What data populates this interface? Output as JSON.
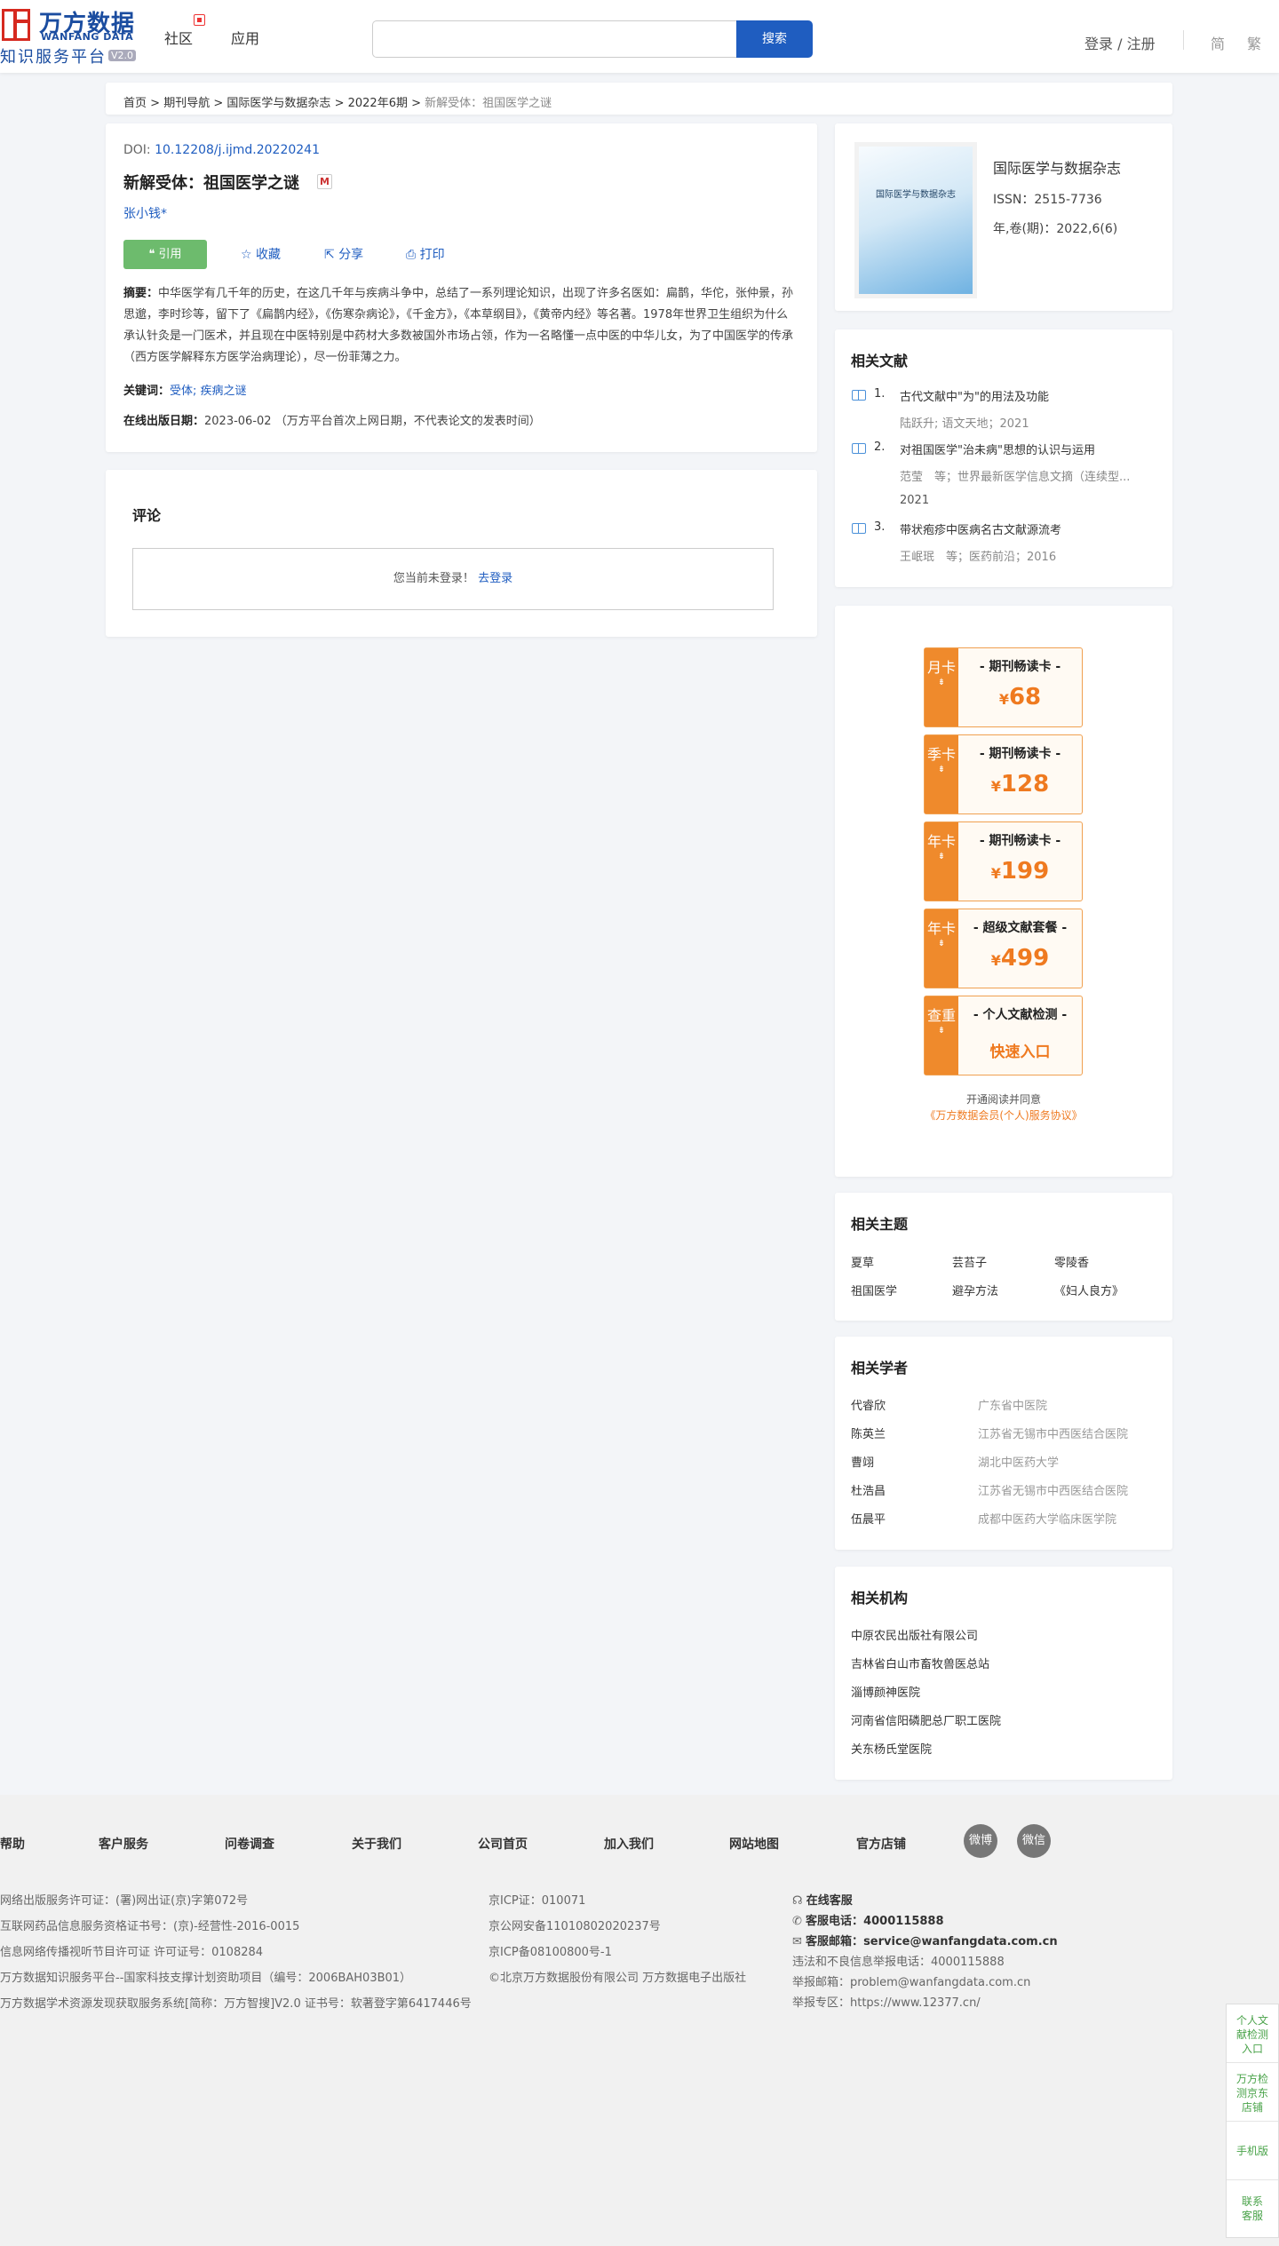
{
  "header": {
    "logo_cn": "万方数据",
    "logo_en": "WANFANG DATA",
    "logo_sub": "知识服务平台",
    "logo_ver": "V2.0",
    "nav": [
      "社区",
      "应用"
    ],
    "search_button": "搜索",
    "login": "登录 / 注册",
    "lang_simplified": "简",
    "lang_traditional": "繁"
  },
  "breadcrumb": {
    "items": [
      "首页",
      "期刊导航",
      "国际医学与数据杂志",
      "2022年6期"
    ],
    "separator": ">",
    "current": "新解受体：祖国医学之谜"
  },
  "article": {
    "doi_label": "DOI:",
    "doi": "10.12208/j.ijmd.20220241",
    "title": "新解受体：祖国医学之谜",
    "m_badge": "M",
    "author": "张小钱*",
    "actions": {
      "cite": "❝ 引用",
      "collect": "收藏",
      "share": "分享",
      "print": "打印"
    },
    "abstract_label": "摘要：",
    "abstract": "中华医学有几千年的历史，在这几千年与疾病斗争中，总结了一系列理论知识，出现了许多名医如：扁鹊，华佗，张仲景，孙思邈，李时珍等，留下了《扁鹊内经》，《伤寒杂病论》，《千金方》，《本草纲目》，《黄帝内经》等名著。1978年世界卫生组织为什么承认针灸是一门医术，并且现在中医特别是中药材大多数被国外市场占领，作为一名略懂一点中医的中华儿女，为了中国医学的传承（西方医学解释东方医学治病理论），尽一份菲薄之力。",
    "keywords_label": "关键词：",
    "keywords": "受体; 疾病之谜",
    "pubdate_label": "在线出版日期：",
    "pubdate": "2023-06-02 （万方平台首次上网日期，不代表论文的发表时间）"
  },
  "comment": {
    "title": "评论",
    "not_logged": "您当前未登录！",
    "login_link": "去登录"
  },
  "journal": {
    "cover_text": "国际医学与数据杂志",
    "name": "国际医学与数据杂志",
    "issn": "ISSN：2515-7736",
    "year": "年,卷(期)：2022,6(6)"
  },
  "related_docs": {
    "title": "相关文献",
    "items": [
      {
        "num": "1.",
        "title": "古代文献中\"为\"的用法及功能",
        "meta": "陆跃升; 语文天地；2021"
      },
      {
        "num": "2.",
        "title": "对祖国医学\"治未病\"思想的认识与运用",
        "meta": "范莹　等；世界最新医学信息文摘（连续型...",
        "year": "2021"
      },
      {
        "num": "3.",
        "title": "带状疱疹中医病名古文献源流考",
        "meta": "王岷珉　等；医药前沿；2016"
      }
    ]
  },
  "packages": {
    "items": [
      {
        "tab": "月卡",
        "name": "- 期刊畅读卡 -",
        "price": "68"
      },
      {
        "tab": "季卡",
        "name": "- 期刊畅读卡 -",
        "price": "128"
      },
      {
        "tab": "年卡",
        "name": "- 期刊畅读卡 -",
        "price": "199"
      },
      {
        "tab": "年卡",
        "name": "- 超级文献套餐 -",
        "price": "499"
      },
      {
        "tab": "查重",
        "name": "- 个人文献检测 -",
        "link": "快速入口"
      }
    ],
    "currency": "¥",
    "arrow": "⇟",
    "agree_text": "开通阅读并同意",
    "agree_link": "《万方数据会员(个人)服务协议》"
  },
  "topics": {
    "title": "相关主题",
    "items": [
      "夏草",
      "芸苔子",
      "零陵香",
      "祖国医学",
      "避孕方法",
      "《妇人良方》"
    ]
  },
  "scholars": {
    "title": "相关学者",
    "items": [
      {
        "name": "代睿欣",
        "org": "广东省中医院"
      },
      {
        "name": "陈英兰",
        "org": "江苏省无锡市中西医结合医院"
      },
      {
        "name": "曹翊",
        "org": "湖北中医药大学"
      },
      {
        "name": "杜浩昌",
        "org": "江苏省无锡市中西医结合医院"
      },
      {
        "name": "伍晨平",
        "org": "成都中医药大学临床医学院"
      }
    ]
  },
  "orgs": {
    "title": "相关机构",
    "items": [
      "中原农民出版社有限公司",
      "吉林省白山市畜牧兽医总站",
      "淄博颜神医院",
      "河南省信阳磷肥总厂职工医院",
      "关东杨氏堂医院"
    ]
  },
  "footer": {
    "links": [
      "帮助",
      "客户服务",
      "问卷调查",
      "关于我们",
      "公司首页",
      "加入我们",
      "网站地图",
      "官方店铺"
    ],
    "social": [
      "微博",
      "微信"
    ],
    "col1": [
      "网络出版服务许可证：(署)网出证(京)字第072号",
      "互联网药品信息服务资格证书号：(京)-经营性-2016-0015",
      "信息网络传播视听节目许可证 许可证号：0108284",
      "万方数据知识服务平台--国家科技支撑计划资助项目（编号：2006BAH03B01）",
      "万方数据学术资源发现获取服务系统[简称：万方智搜]V2.0 证书号：软著登字第6417446号"
    ],
    "col2": [
      "京ICP证：010071",
      "京公网安备11010802020237号",
      "京ICP备08100800号-1",
      "©北京万方数据股份有限公司 万方数据电子出版社"
    ],
    "online_service": "在线客服",
    "phone_label": "客服电话：",
    "phone": "4000115888",
    "email_label": "客服邮箱：",
    "email": "service@wanfangdata.com.cn",
    "report_phone": "违法和不良信息举报电话：4000115888",
    "report_email": "举报邮箱：problem@wanfangdata.com.cn",
    "report_site": "举报专区：https://www.12377.cn/"
  },
  "float_bar": [
    "个人文献检测入口",
    "万方检测京东店铺",
    "手机版",
    "联系客服"
  ],
  "colors": {
    "brand_blue": "#1f5dc0",
    "logo_red": "#d6291f",
    "cite_green": "#6dbb6d",
    "package_orange": "#ef8a2c"
  }
}
